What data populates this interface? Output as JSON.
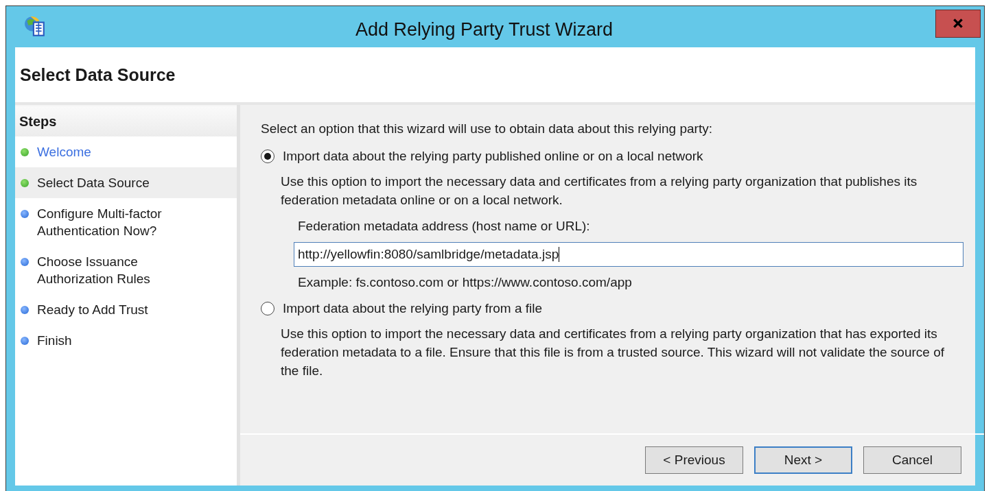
{
  "window": {
    "title": "Add Relying Party Trust Wizard"
  },
  "page_title": "Select Data Source",
  "steps": {
    "heading": "Steps",
    "items": [
      {
        "label": "Welcome",
        "done": true,
        "selected": false,
        "link": true
      },
      {
        "label": "Select Data Source",
        "done": true,
        "selected": true,
        "link": false
      },
      {
        "label": "Configure Multi-factor Authentication Now?",
        "done": false,
        "selected": false,
        "link": false
      },
      {
        "label": "Choose Issuance Authorization Rules",
        "done": false,
        "selected": false,
        "link": false
      },
      {
        "label": "Ready to Add Trust",
        "done": false,
        "selected": false,
        "link": false
      },
      {
        "label": "Finish",
        "done": false,
        "selected": false,
        "link": false
      }
    ]
  },
  "intro": "Select an option that this wizard will use to obtain data about this relying party:",
  "options": [
    {
      "label": "Import data about the relying party published online or on a local network",
      "selected": true,
      "description": "Use this option to import the necessary data and certificates from a relying party organization that publishes its federation metadata online or on a local network.",
      "address": {
        "label": "Federation metadata address (host name or URL):",
        "value": "http://yellowfin:8080/samlbridge/metadata.jsp",
        "example": "Example: fs.contoso.com or https://www.contoso.com/app"
      }
    },
    {
      "label": "Import data about the relying party from a file",
      "selected": false,
      "description": "Use this option to import the necessary data and certificates from a relying party organization that has exported its federation metadata to a file. Ensure that this file is from a trusted source.  This wizard will not validate the source of the file."
    }
  ],
  "buttons": [
    {
      "label": "< Previous",
      "default": false
    },
    {
      "label": "Next >",
      "default": true
    },
    {
      "label": "Cancel",
      "default": false
    }
  ]
}
